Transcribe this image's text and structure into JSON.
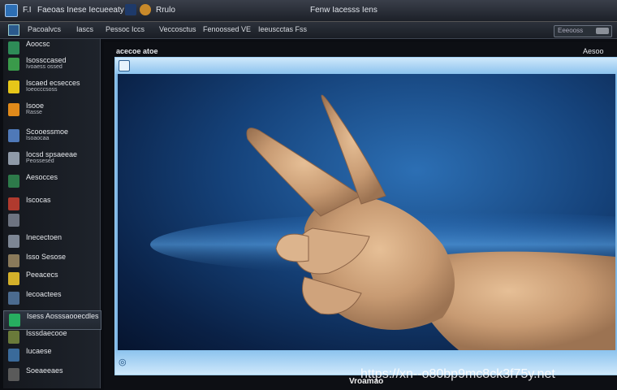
{
  "window": {
    "title_left": "Faeoas Inese Iecueeaty",
    "title_center": "Fenw Iacesss Iens",
    "title_badge": "Rrulo",
    "title_prefix": "F.I"
  },
  "menu": {
    "items": [
      "Pacoalvcs",
      "Iascs",
      "Pessoc Iccs",
      "Veccosctus",
      "Fenoossed VE",
      "Ieeuscctas Fss"
    ],
    "search_placeholder": "Eeeooss"
  },
  "sidebar": {
    "items": [
      {
        "label": "Aoocsc",
        "sub": "",
        "color": "#2e8b57"
      },
      {
        "label": "Isossccased",
        "sub": "Ivoaess ossed",
        "color": "#3a9a4a"
      },
      {
        "label": "Iscaed ecsecces",
        "sub": "Ioeocccsoss",
        "color": "#e6c619"
      },
      {
        "label": "Isooe",
        "sub": "Rasse",
        "color": "#e08a1a"
      },
      {
        "label": "Scooessmoe",
        "sub": "Isoaocaa",
        "color": "#4f79b8"
      },
      {
        "label": "Iocsd spsaeeae",
        "sub": "Peossesed",
        "color": "#8f9aa8"
      },
      {
        "label": "Aesocces",
        "sub": "",
        "color": "#2d7a4a"
      },
      {
        "label": "Iscocas",
        "sub": "",
        "color": "#b03a2e"
      },
      {
        "label": "",
        "sub": "",
        "color": "#6d7380"
      },
      {
        "label": "Inecectoen",
        "sub": "",
        "color": "#7d8694"
      },
      {
        "label": "Isso Sesose",
        "sub": "",
        "color": "#8a7a5a"
      },
      {
        "label": "Peeacecs",
        "sub": "",
        "color": "#d4b12a"
      },
      {
        "label": "Iecoactees",
        "sub": "",
        "color": "#4b6b8f"
      },
      {
        "label": "Isess Aosssaooecdles",
        "sub": "",
        "color": "#27ae60"
      },
      {
        "label": "Isssdaecooe",
        "sub": "",
        "color": "#6a7a3a"
      },
      {
        "label": "Iucaese",
        "sub": "",
        "color": "#3a6a9a"
      },
      {
        "label": "Soeaeeaes",
        "sub": "",
        "color": "#5a5a5a"
      }
    ]
  },
  "content": {
    "header_title": "acecoe atoe",
    "header_corner": "Aesoo",
    "bottom_label": "Vroamao",
    "watermark": "https://xn--o80bp9mc8ck3f75y.net"
  },
  "colors": {
    "accent": "#7fb8e6",
    "background": "#0b0d12",
    "selected": "#2d3440"
  }
}
